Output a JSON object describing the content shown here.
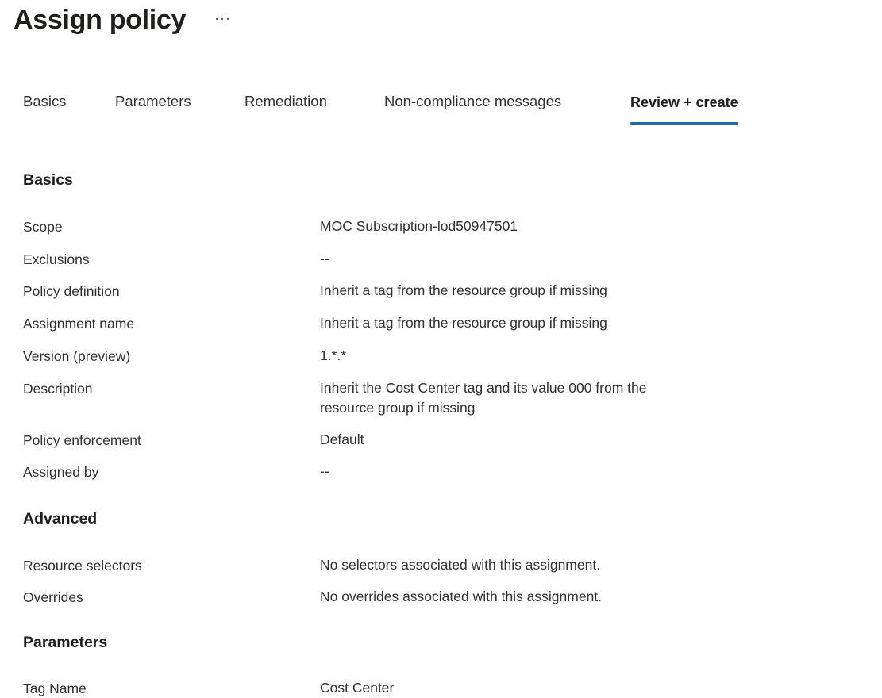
{
  "header": {
    "title": "Assign policy",
    "more_icon": "ellipsis-icon"
  },
  "tabs": [
    {
      "label": "Basics",
      "active": false
    },
    {
      "label": "Parameters",
      "active": false
    },
    {
      "label": "Remediation",
      "active": false
    },
    {
      "label": "Non-compliance messages",
      "active": false
    },
    {
      "label": "Review + create",
      "active": true
    }
  ],
  "accent_color": "#0f6cbd",
  "sections": {
    "basics": {
      "heading": "Basics",
      "rows": [
        {
          "label": "Scope",
          "value": "MOC Subscription-lod50947501"
        },
        {
          "label": "Exclusions",
          "value": "--"
        },
        {
          "label": "Policy definition",
          "value": "Inherit a tag from the resource group if missing"
        },
        {
          "label": "Assignment name",
          "value": "Inherit a tag from the resource group if missing"
        },
        {
          "label": "Version (preview)",
          "value": "1.*.*"
        },
        {
          "label": "Description",
          "value": "Inherit the Cost Center tag and its value 000 from the resource group if missing"
        },
        {
          "label": "Policy enforcement",
          "value": "Default"
        },
        {
          "label": "Assigned by",
          "value": "--"
        }
      ]
    },
    "advanced": {
      "heading": "Advanced",
      "rows": [
        {
          "label": "Resource selectors",
          "value": "No selectors associated with this assignment."
        },
        {
          "label": "Overrides",
          "value": "No overrides associated with this assignment."
        }
      ]
    },
    "parameters": {
      "heading": "Parameters",
      "rows": [
        {
          "label": "Tag Name",
          "value": "Cost Center"
        }
      ]
    }
  }
}
